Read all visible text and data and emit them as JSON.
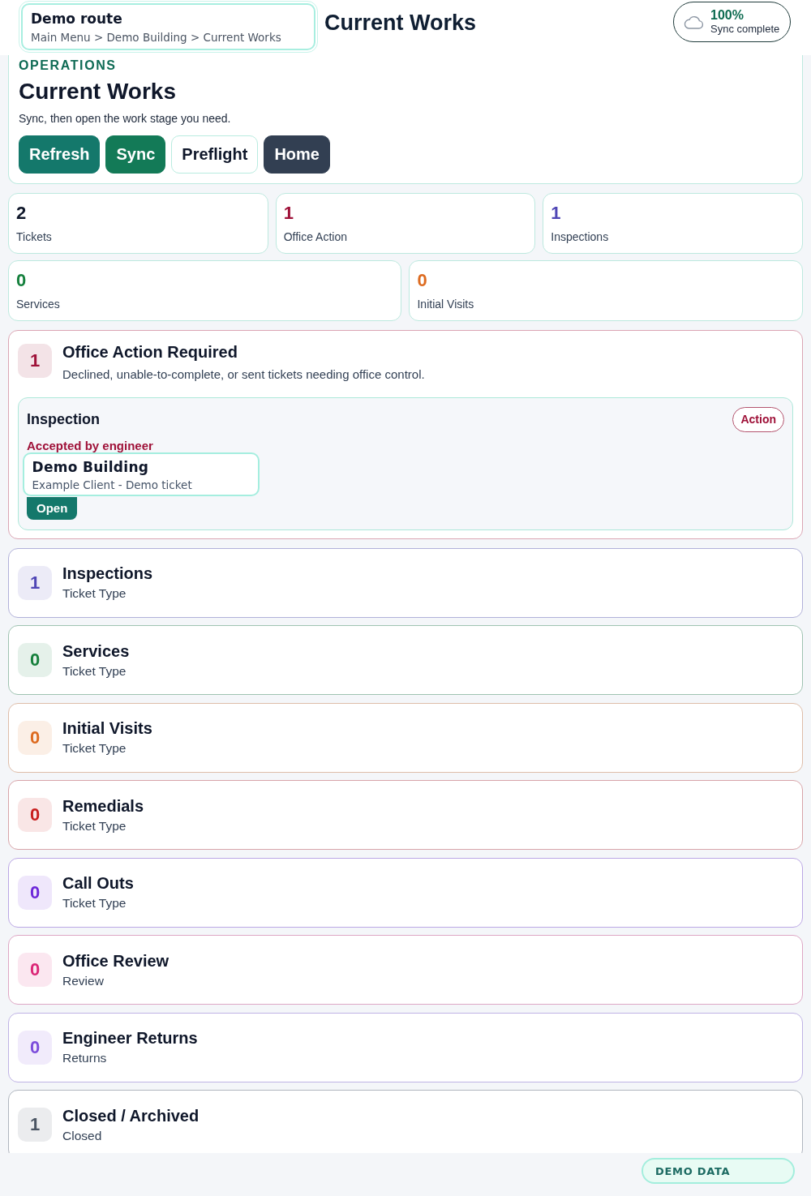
{
  "header": {
    "route_title": "Demo route",
    "breadcrumb": "Main Menu > Demo Building > Current Works",
    "page_title": "Current Works",
    "sync": {
      "percent": "100%",
      "status": "Sync complete"
    }
  },
  "hero": {
    "eyebrow": "OPERATIONS",
    "title": "Current Works",
    "subtitle": "Sync, then open the work stage you need.",
    "buttons": [
      {
        "label": "Refresh",
        "kind": "teal"
      },
      {
        "label": "Sync",
        "kind": "green"
      },
      {
        "label": "Preflight",
        "kind": "outline"
      },
      {
        "label": "Home",
        "kind": "dark"
      }
    ]
  },
  "stats": [
    {
      "value": "2",
      "label": "Tickets",
      "color": "#0f172a"
    },
    {
      "value": "1",
      "label": "Office Action",
      "color": "#9f1239"
    },
    {
      "value": "1",
      "label": "Inspections",
      "color": "#4f46b5"
    },
    {
      "value": "0",
      "label": "Services",
      "color": "#15803d"
    },
    {
      "value": "0",
      "label": "Initial Visits",
      "color": "#dd6b20"
    }
  ],
  "office_action": {
    "count": "1",
    "color": "#9f1239",
    "title": "Office Action Required",
    "description": "Declined, unable-to-complete, or sent tickets needing office control.",
    "tickets": [
      {
        "type": "Inspection",
        "tag": "Action",
        "status": "Accepted by engineer",
        "button": "Open",
        "popover": {
          "title": "Demo Building",
          "subtitle": "Example Client - Demo ticket"
        }
      }
    ]
  },
  "stages": [
    {
      "count": "1",
      "title": "Inspections",
      "subtitle": "Ticket Type",
      "color": "#4f46b5"
    },
    {
      "count": "0",
      "title": "Services",
      "subtitle": "Ticket Type",
      "color": "#16803c"
    },
    {
      "count": "0",
      "title": "Initial Visits",
      "subtitle": "Ticket Type",
      "color": "#dd6b20"
    },
    {
      "count": "0",
      "title": "Remedials",
      "subtitle": "Ticket Type",
      "color": "#c81e1e"
    },
    {
      "count": "0",
      "title": "Call Outs",
      "subtitle": "Ticket Type",
      "color": "#6d28d9"
    },
    {
      "count": "0",
      "title": "Office Review",
      "subtitle": "Review",
      "color": "#db2777"
    },
    {
      "count": "0",
      "title": "Engineer Returns",
      "subtitle": "Returns",
      "color": "#7c4ddb"
    },
    {
      "count": "1",
      "title": "Closed / Archived",
      "subtitle": "Closed",
      "color": "#4b5563"
    }
  ],
  "footer": {
    "badge": "DEMO DATA"
  }
}
